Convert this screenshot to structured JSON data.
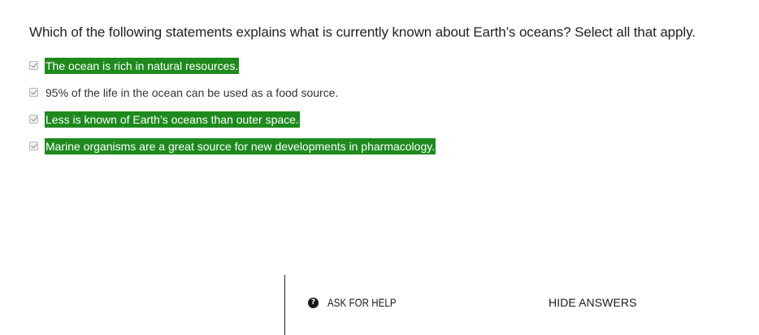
{
  "question": {
    "text": "Which of the following statements explains what is currently known about Earth’s oceans? Select all that apply."
  },
  "options": [
    {
      "text": "The ocean is rich in natural resources.",
      "checked": true,
      "highlighted": true
    },
    {
      "text": "95% of the life in the ocean can be used as a food source.",
      "checked": true,
      "highlighted": false
    },
    {
      "text": "Less is known of Earth’s oceans than outer space.",
      "checked": true,
      "highlighted": true
    },
    {
      "text": "Marine organisms are a great source for new developments in pharmacology.",
      "checked": true,
      "highlighted": true
    }
  ],
  "footer": {
    "ask_for_help_label": "ASK FOR HELP",
    "help_icon_glyph": "?",
    "hide_answers_label": "HIDE ANSWERS"
  },
  "colors": {
    "correct_highlight": "#1e8a1e",
    "text": "#222222"
  }
}
